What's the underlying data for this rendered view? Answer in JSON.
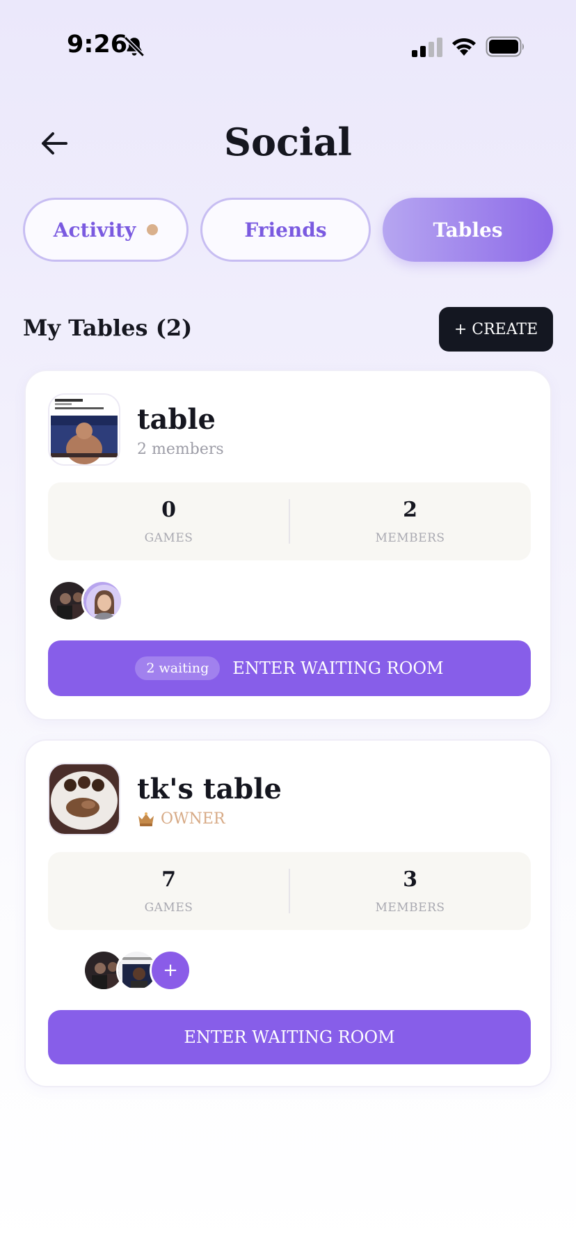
{
  "status_bar": {
    "time": "9:26"
  },
  "header": {
    "title": "Social"
  },
  "tabs": [
    {
      "label": "Activity",
      "has_notification": true
    },
    {
      "label": "Friends"
    },
    {
      "label": "Tables",
      "active": true
    }
  ],
  "section": {
    "title": "My Tables (2)",
    "create_label": "+ CREATE"
  },
  "tables": [
    {
      "name": "table",
      "subtitle": "2 members",
      "games_value": "0",
      "games_label": "GAMES",
      "members_value": "2",
      "members_label": "MEMBERS",
      "waiting_badge": "2 waiting",
      "button_label": "ENTER WAITING ROOM"
    },
    {
      "name": "tk's table",
      "owner_icon": "crown-icon",
      "subtitle": "OWNER",
      "games_value": "7",
      "games_label": "GAMES",
      "members_value": "3",
      "members_label": "MEMBERS",
      "add_label": "+",
      "button_label": "ENTER WAITING ROOM"
    }
  ],
  "colors": {
    "accent": "#875ee9",
    "dark": "#141721",
    "owner": "#d7aa86"
  }
}
